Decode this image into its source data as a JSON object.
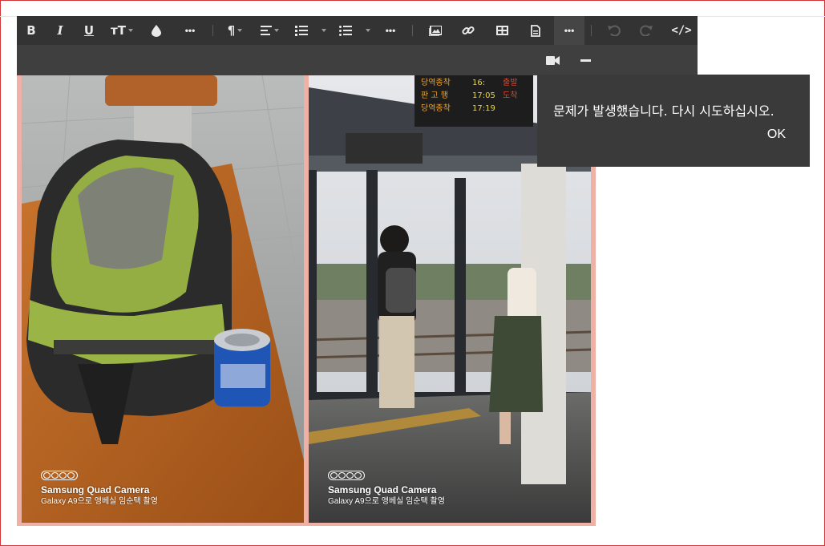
{
  "toolbar": {
    "bold_label": "B",
    "italic_label": "I",
    "underline_label": "U",
    "font_size_label": "тT",
    "more1_label": "•••",
    "more2_label": "•••",
    "more3_label": "•••",
    "paragraph_label": "¶",
    "code_view_label": "</>"
  },
  "content": {
    "left_photo": {
      "brand": "Samsung Quad Camera",
      "caption": "Galaxy A9으로 앵베실 임순택 촬영"
    },
    "right_photo": {
      "brand": "Samsung Quad Camera",
      "caption": "Galaxy A9으로 앵베실 임순택 촬영",
      "sign_lines": [
        "당역종착",
        "판 고 행",
        "당역종착"
      ],
      "sign_times": [
        "16:",
        "17:05",
        "17:19"
      ],
      "sign_status": [
        "출발",
        "도착"
      ]
    }
  },
  "toast": {
    "message": "문제가 발생했습니다. 다시 시도하십시오.",
    "ok_label": "OK"
  },
  "colors": {
    "toolbar_bg": "#333333",
    "toast_bg": "#3a3a3a",
    "border_accent": "#d0373a",
    "photo_frame": "#efb1a5"
  }
}
